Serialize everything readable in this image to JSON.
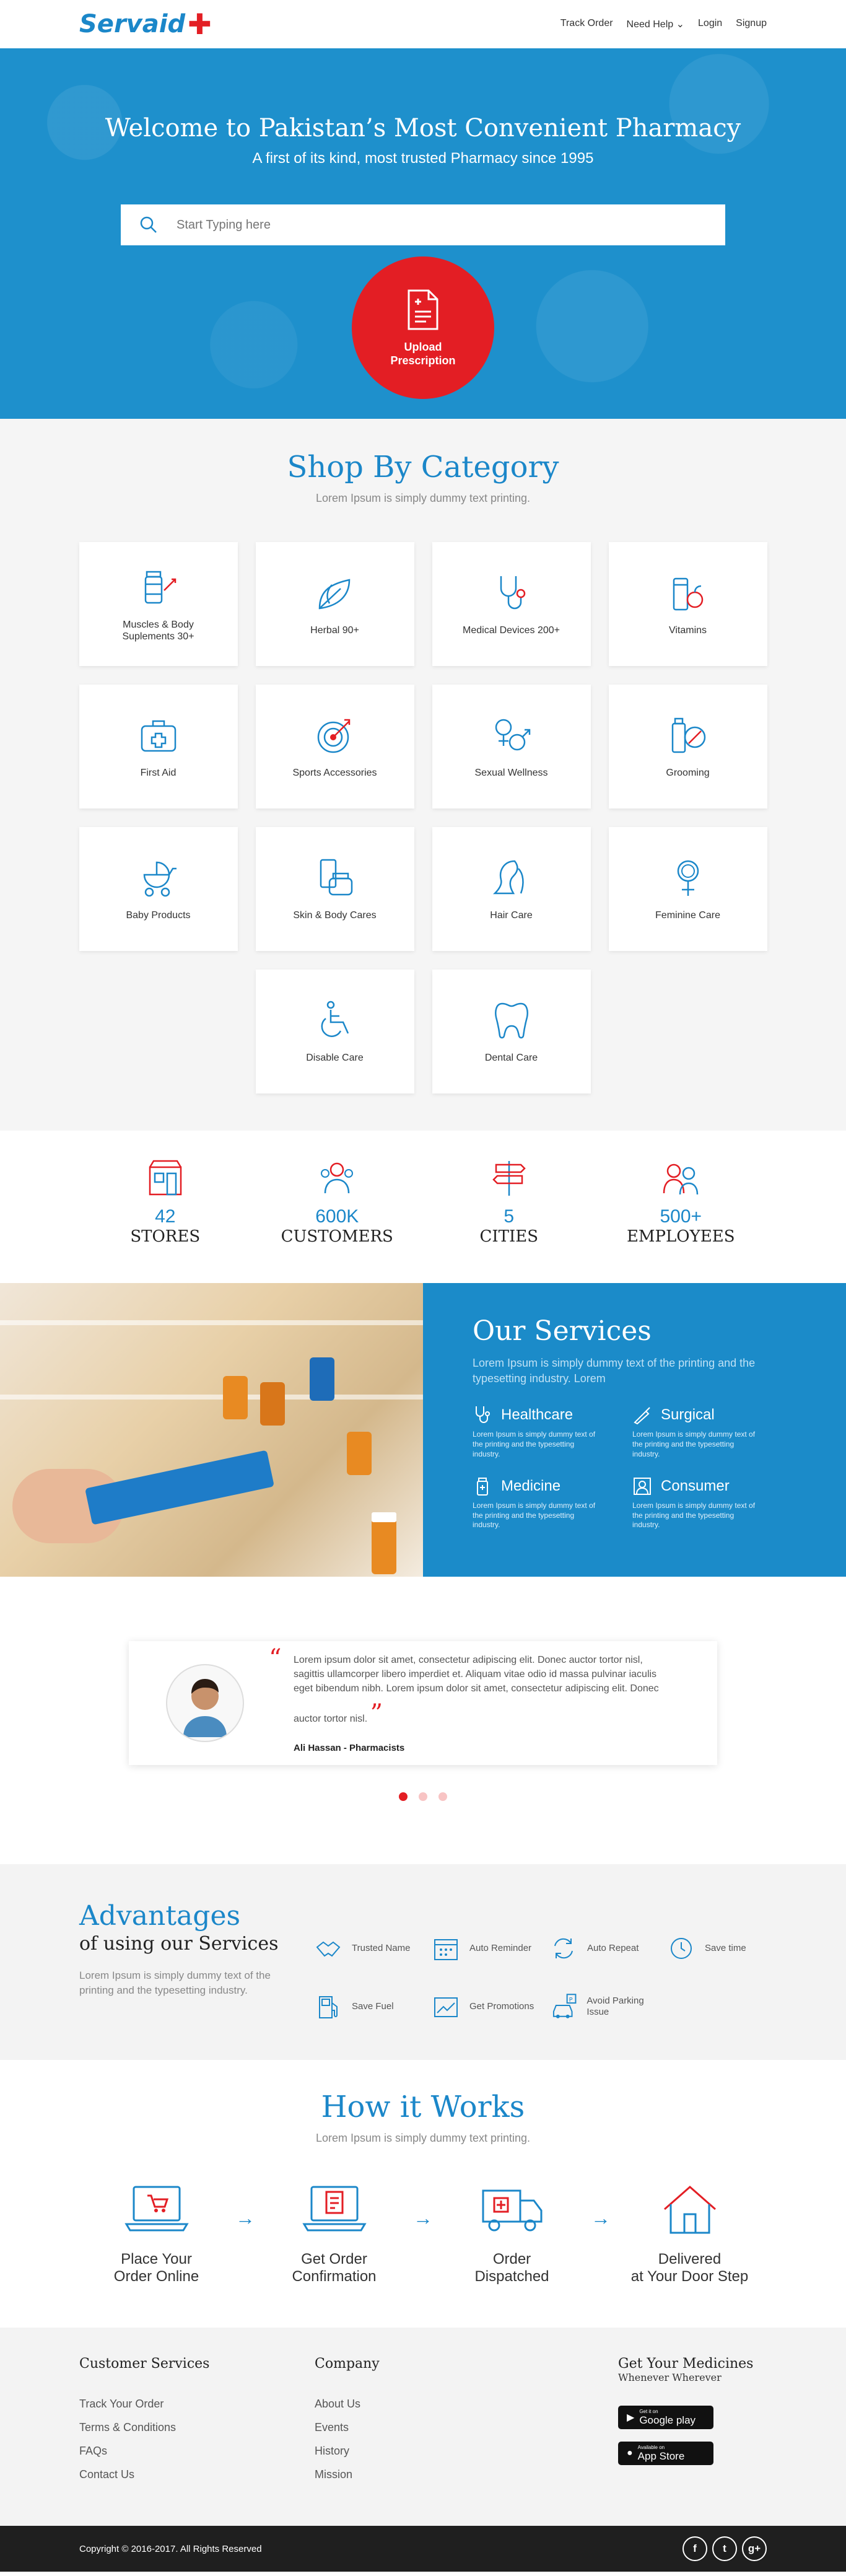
{
  "brand": {
    "name": "Servaid",
    "primary": "#1b87c9",
    "accent": "#e31e24"
  },
  "nav": {
    "items": [
      "Track Order",
      "Need Help",
      "Login",
      "Signup"
    ]
  },
  "hero": {
    "title": "Welcome to Pakistan’s Most Convenient Pharmacy",
    "subtitle": "A first of its kind, most trusted Pharmacy since 1995",
    "search_placeholder": "Start Typing here",
    "upload_line1": "Upload",
    "upload_line2": "Prescription"
  },
  "category": {
    "title": "Shop By Category",
    "subtitle": "Lorem Ipsum is simply dummy text printing.",
    "items": [
      {
        "label": "Muscles & Body Suplements 30+",
        "icon": "supplement-icon"
      },
      {
        "label": "Herbal 90+",
        "icon": "leaf-icon"
      },
      {
        "label": "Medical Devices 200+",
        "icon": "stethoscope-icon"
      },
      {
        "label": "Vitamins",
        "icon": "vitamins-icon"
      },
      {
        "label": "First Aid",
        "icon": "first-aid-icon"
      },
      {
        "label": "Sports Accessories",
        "icon": "target-icon"
      },
      {
        "label": "Sexual Wellness",
        "icon": "gender-icon"
      },
      {
        "label": "Grooming",
        "icon": "razor-icon"
      },
      {
        "label": "Baby Products",
        "icon": "stroller-icon"
      },
      {
        "label": "Skin & Body Cares",
        "icon": "cream-icon"
      },
      {
        "label": "Hair Care",
        "icon": "hair-icon"
      },
      {
        "label": "Feminine Care",
        "icon": "female-icon"
      },
      {
        "label": "Disable Care",
        "icon": "wheelchair-icon"
      },
      {
        "label": "Dental Care",
        "icon": "tooth-icon"
      }
    ]
  },
  "stats": [
    {
      "num": "42",
      "label": "STORES",
      "icon": "store-icon"
    },
    {
      "num": "600K",
      "label": "CUSTOMERS",
      "icon": "customers-icon"
    },
    {
      "num": "5",
      "label": "CITIES",
      "icon": "signpost-icon"
    },
    {
      "num": "500+",
      "label": "EMPLOYEES",
      "icon": "employees-icon"
    }
  ],
  "services": {
    "title": "Our Services",
    "desc": "Lorem Ipsum is simply dummy text of the printing and the typesetting industry. Lorem",
    "items": [
      {
        "title": "Healthcare",
        "desc": "Lorem Ipsum is simply dummy text of the printing and the typesetting industry."
      },
      {
        "title": "Surgical",
        "desc": "Lorem Ipsum is simply dummy text of the printing and the typesetting industry."
      },
      {
        "title": "Medicine",
        "desc": "Lorem Ipsum is simply dummy text of the printing and the typesetting industry."
      },
      {
        "title": "Consumer",
        "desc": "Lorem Ipsum is simply dummy text of the printing and the typesetting industry."
      }
    ]
  },
  "testimonial": {
    "quote": "Lorem ipsum dolor sit amet, consectetur adipiscing elit. Donec auctor tortor nisl, sagittis ullamcorper libero imperdiet et. Aliquam vitae odio id massa pulvinar iaculis eget bibendum nibh. Lorem ipsum dolor sit amet, consectetur adipiscing elit. Donec auctor tortor nisl.",
    "author": "Ali Hassan - Pharmacists"
  },
  "advantages": {
    "title": "Advantages",
    "subtitle": "of using our Services",
    "desc": "Lorem Ipsum is simply dummy text of the printing and the typesetting industry.",
    "items": [
      {
        "label": "Trusted Name"
      },
      {
        "label": "Auto Reminder"
      },
      {
        "label": "Auto Repeat"
      },
      {
        "label": "Save time"
      },
      {
        "label": "Save Fuel"
      },
      {
        "label": "Get Promotions"
      },
      {
        "label": "Avoid Parking Issue"
      }
    ]
  },
  "how": {
    "title": "How it Works",
    "subtitle": "Lorem Ipsum is simply dummy text printing.",
    "steps": [
      {
        "l1": "Place Your",
        "l2": "Order Online"
      },
      {
        "l1": "Get Order",
        "l2": "Confirmation"
      },
      {
        "l1": "Order",
        "l2": "Dispatched"
      },
      {
        "l1": "Delivered",
        "l2": "at Your Door Step"
      }
    ]
  },
  "footer": {
    "customer_title": "Customer Services",
    "customer_links": [
      "Track Your Order",
      "Terms & Conditions",
      "FAQs",
      "Contact Us"
    ],
    "company_title": "Company",
    "company_links": [
      "About Us",
      "Events",
      "History",
      "Mission"
    ],
    "apps_title": "Get Your Medicines",
    "apps_sub": "Whenever Wherever",
    "google": {
      "small": "Get it on",
      "big": "Google play"
    },
    "apple": {
      "small": "Available on",
      "big": "App Store"
    },
    "copyright": "Copyright © 2016-2017. All Rights Reserved"
  }
}
